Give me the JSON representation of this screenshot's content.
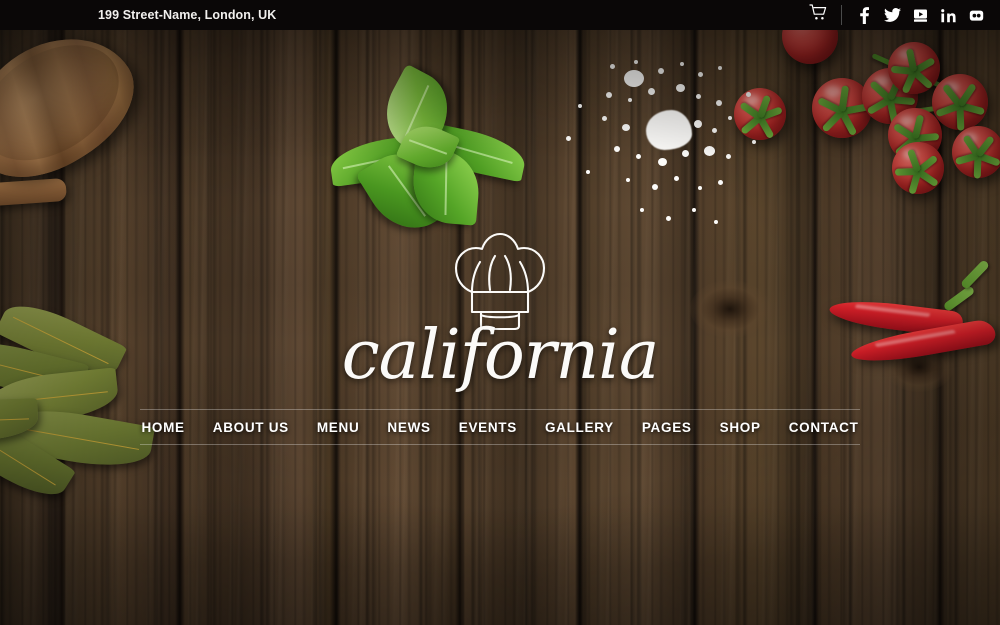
{
  "topbar": {
    "address": "199 Street-Name, London, UK",
    "cart_icon": "shopping-cart-icon",
    "social": [
      {
        "name": "facebook",
        "label": "Facebook",
        "glyph": "f"
      },
      {
        "name": "twitter",
        "label": "Twitter",
        "glyph": "bird"
      },
      {
        "name": "youtube",
        "label": "YouTube",
        "glyph": "youtube"
      },
      {
        "name": "linkedin",
        "label": "LinkedIn",
        "glyph": "in"
      },
      {
        "name": "flickr",
        "label": "Flickr",
        "glyph": "dots"
      }
    ],
    "background_color": "#0a0707",
    "text_color": "#f2f0ee"
  },
  "logo": {
    "wordmark": "california",
    "icon": "chef-hat-icon",
    "color": "#fbfaf8"
  },
  "nav": {
    "items": [
      {
        "label": "HOME"
      },
      {
        "label": "ABOUT US"
      },
      {
        "label": "MENU"
      },
      {
        "label": "NEWS"
      },
      {
        "label": "EVENTS"
      },
      {
        "label": "GALLERY"
      },
      {
        "label": "PAGES"
      },
      {
        "label": "SHOP"
      },
      {
        "label": "CONTACT"
      }
    ],
    "text_color": "#ffffff",
    "rule_color": "rgba(255,255,255,0.30)"
  },
  "hero": {
    "background": "rustic-dark-wood-planks",
    "background_color": "#40301f",
    "props": [
      {
        "name": "wooden-spoon",
        "color": "#b8834f"
      },
      {
        "name": "basil-leaves",
        "color": "#5aa32a"
      },
      {
        "name": "bay-leaves",
        "color": "#7f8c3c"
      },
      {
        "name": "cherry-tomatoes",
        "color": "#c6302d"
      },
      {
        "name": "salt-scatter",
        "color": "#fdfcfa"
      },
      {
        "name": "red-chili-peppers",
        "color": "#d61f28"
      }
    ]
  }
}
